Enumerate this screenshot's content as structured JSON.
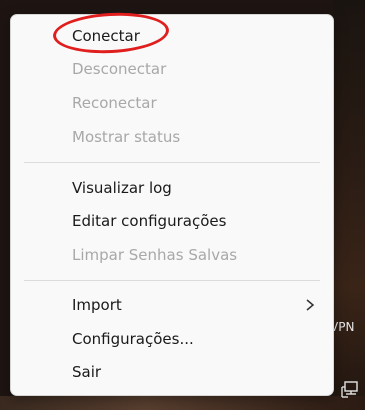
{
  "taskbar": {
    "vpn_label": "VPN"
  },
  "menu": {
    "group1": [
      {
        "label": "Conectar",
        "enabled": true
      },
      {
        "label": "Desconectar",
        "enabled": false
      },
      {
        "label": "Reconectar",
        "enabled": false
      },
      {
        "label": "Mostrar status",
        "enabled": false
      }
    ],
    "group2": [
      {
        "label": "Visualizar log",
        "enabled": true
      },
      {
        "label": "Editar configurações",
        "enabled": true
      },
      {
        "label": "Limpar Senhas Salvas",
        "enabled": false
      }
    ],
    "group3": [
      {
        "label": "Import",
        "enabled": true,
        "submenu": true
      },
      {
        "label": "Configurações...",
        "enabled": true
      },
      {
        "label": "Sair",
        "enabled": true
      }
    ]
  },
  "icons": {
    "submenu": "chevron-right-icon",
    "tray": "network-tray-icon"
  },
  "colors": {
    "annotation": "#e01e1e",
    "disabled_text": "#a8a8a8",
    "menu_background": "#f9f9f9"
  }
}
